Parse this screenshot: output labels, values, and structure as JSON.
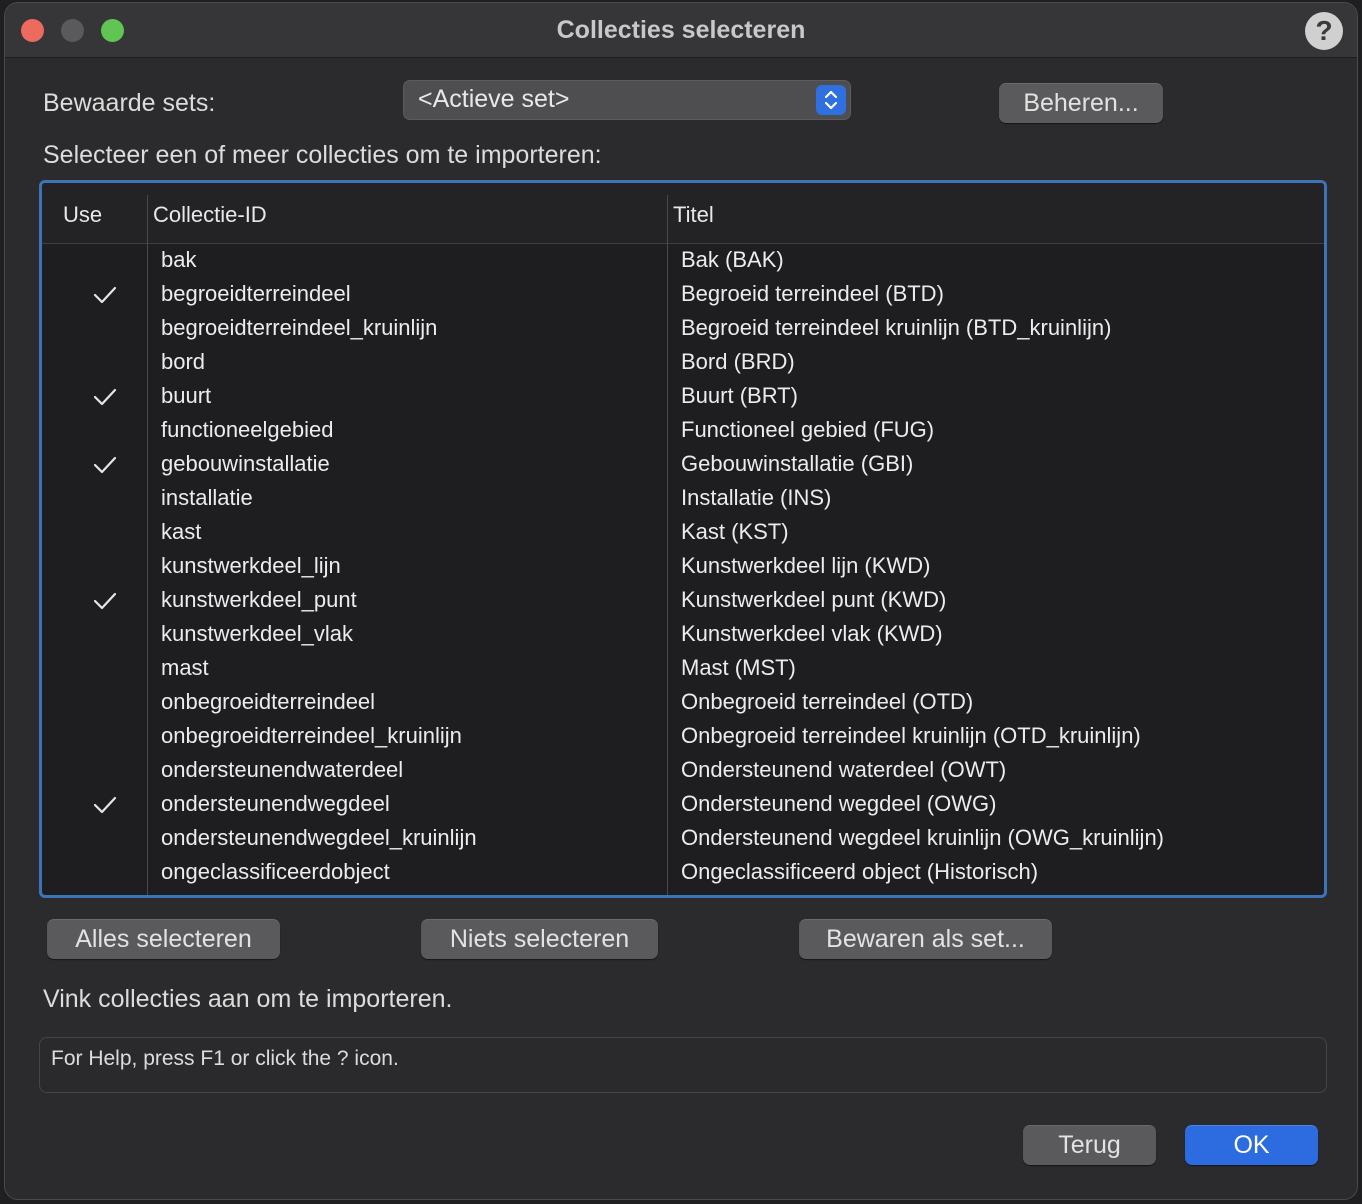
{
  "window": {
    "title": "Collecties selecteren",
    "help_label": "?"
  },
  "saved_sets": {
    "label": "Bewaarde sets:",
    "selected": "<Actieve set>",
    "manage_button": "Beheren..."
  },
  "instruction": "Selecteer een of meer collecties om te importeren:",
  "table": {
    "columns": [
      "Use",
      "Collectie-ID",
      "Titel"
    ],
    "rows": [
      {
        "use": false,
        "id": "bak",
        "title": "Bak (BAK)"
      },
      {
        "use": true,
        "id": "begroeidterreindeel",
        "title": "Begroeid terreindeel (BTD)"
      },
      {
        "use": false,
        "id": "begroeidterreindeel_kruinlijn",
        "title": "Begroeid terreindeel kruinlijn (BTD_kruinlijn)"
      },
      {
        "use": false,
        "id": "bord",
        "title": "Bord (BRD)"
      },
      {
        "use": true,
        "id": "buurt",
        "title": "Buurt (BRT)"
      },
      {
        "use": false,
        "id": "functioneelgebied",
        "title": "Functioneel gebied (FUG)"
      },
      {
        "use": true,
        "id": "gebouwinstallatie",
        "title": "Gebouwinstallatie (GBI)"
      },
      {
        "use": false,
        "id": "installatie",
        "title": "Installatie (INS)"
      },
      {
        "use": false,
        "id": "kast",
        "title": "Kast (KST)"
      },
      {
        "use": false,
        "id": "kunstwerkdeel_lijn",
        "title": "Kunstwerkdeel lijn (KWD)"
      },
      {
        "use": true,
        "id": "kunstwerkdeel_punt",
        "title": "Kunstwerkdeel punt (KWD)"
      },
      {
        "use": false,
        "id": "kunstwerkdeel_vlak",
        "title": "Kunstwerkdeel vlak (KWD)"
      },
      {
        "use": false,
        "id": "mast",
        "title": "Mast (MST)"
      },
      {
        "use": false,
        "id": "onbegroeidterreindeel",
        "title": "Onbegroeid terreindeel (OTD)"
      },
      {
        "use": false,
        "id": "onbegroeidterreindeel_kruinlijn",
        "title": "Onbegroeid terreindeel kruinlijn (OTD_kruinlijn)"
      },
      {
        "use": false,
        "id": "ondersteunendwaterdeel",
        "title": "Ondersteunend waterdeel (OWT)"
      },
      {
        "use": true,
        "id": "ondersteunendwegdeel",
        "title": "Ondersteunend wegdeel (OWG)"
      },
      {
        "use": false,
        "id": "ondersteunendwegdeel_kruinlijn",
        "title": "Ondersteunend wegdeel kruinlijn (OWG_kruinlijn)"
      },
      {
        "use": false,
        "id": "ongeclassificeerdobject",
        "title": "Ongeclassificeerd object (Historisch)"
      }
    ]
  },
  "actions": {
    "select_all": "Alles selecteren",
    "select_none": "Niets selecteren",
    "save_as_set": "Bewaren als set..."
  },
  "hint": "Vink collecties aan om te importeren.",
  "status": "For Help, press F1 or click the ? icon.",
  "footer": {
    "back_button": "Terug",
    "ok_button": "OK"
  },
  "colors": {
    "accent": "#2d6be0",
    "table_border": "#3d73b8",
    "close": "#ed6a5e",
    "maximize": "#61c554"
  }
}
